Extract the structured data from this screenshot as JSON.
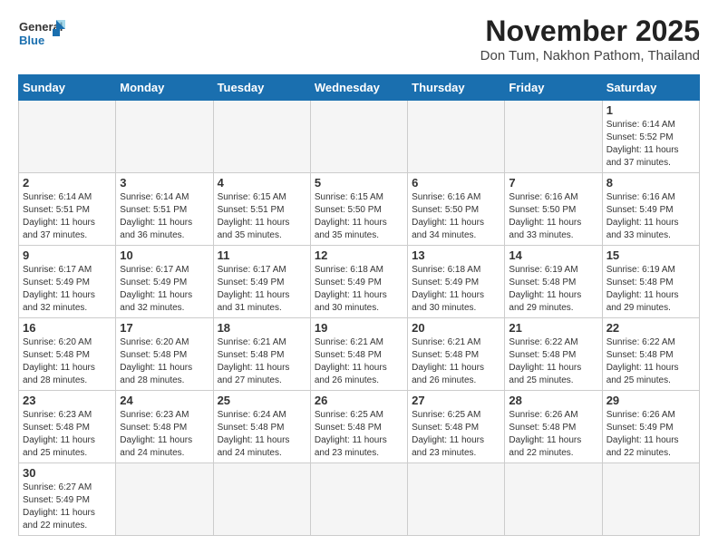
{
  "header": {
    "logo_general": "General",
    "logo_blue": "Blue",
    "month_title": "November 2025",
    "location": "Don Tum, Nakhon Pathom, Thailand"
  },
  "weekdays": [
    "Sunday",
    "Monday",
    "Tuesday",
    "Wednesday",
    "Thursday",
    "Friday",
    "Saturday"
  ],
  "days": [
    {
      "num": "",
      "info": ""
    },
    {
      "num": "",
      "info": ""
    },
    {
      "num": "",
      "info": ""
    },
    {
      "num": "",
      "info": ""
    },
    {
      "num": "",
      "info": ""
    },
    {
      "num": "",
      "info": ""
    },
    {
      "num": "1",
      "info": "Sunrise: 6:14 AM\nSunset: 5:52 PM\nDaylight: 11 hours and 37 minutes."
    },
    {
      "num": "2",
      "info": "Sunrise: 6:14 AM\nSunset: 5:51 PM\nDaylight: 11 hours and 37 minutes."
    },
    {
      "num": "3",
      "info": "Sunrise: 6:14 AM\nSunset: 5:51 PM\nDaylight: 11 hours and 36 minutes."
    },
    {
      "num": "4",
      "info": "Sunrise: 6:15 AM\nSunset: 5:51 PM\nDaylight: 11 hours and 35 minutes."
    },
    {
      "num": "5",
      "info": "Sunrise: 6:15 AM\nSunset: 5:50 PM\nDaylight: 11 hours and 35 minutes."
    },
    {
      "num": "6",
      "info": "Sunrise: 6:16 AM\nSunset: 5:50 PM\nDaylight: 11 hours and 34 minutes."
    },
    {
      "num": "7",
      "info": "Sunrise: 6:16 AM\nSunset: 5:50 PM\nDaylight: 11 hours and 33 minutes."
    },
    {
      "num": "8",
      "info": "Sunrise: 6:16 AM\nSunset: 5:49 PM\nDaylight: 11 hours and 33 minutes."
    },
    {
      "num": "9",
      "info": "Sunrise: 6:17 AM\nSunset: 5:49 PM\nDaylight: 11 hours and 32 minutes."
    },
    {
      "num": "10",
      "info": "Sunrise: 6:17 AM\nSunset: 5:49 PM\nDaylight: 11 hours and 32 minutes."
    },
    {
      "num": "11",
      "info": "Sunrise: 6:17 AM\nSunset: 5:49 PM\nDaylight: 11 hours and 31 minutes."
    },
    {
      "num": "12",
      "info": "Sunrise: 6:18 AM\nSunset: 5:49 PM\nDaylight: 11 hours and 30 minutes."
    },
    {
      "num": "13",
      "info": "Sunrise: 6:18 AM\nSunset: 5:49 PM\nDaylight: 11 hours and 30 minutes."
    },
    {
      "num": "14",
      "info": "Sunrise: 6:19 AM\nSunset: 5:48 PM\nDaylight: 11 hours and 29 minutes."
    },
    {
      "num": "15",
      "info": "Sunrise: 6:19 AM\nSunset: 5:48 PM\nDaylight: 11 hours and 29 minutes."
    },
    {
      "num": "16",
      "info": "Sunrise: 6:20 AM\nSunset: 5:48 PM\nDaylight: 11 hours and 28 minutes."
    },
    {
      "num": "17",
      "info": "Sunrise: 6:20 AM\nSunset: 5:48 PM\nDaylight: 11 hours and 28 minutes."
    },
    {
      "num": "18",
      "info": "Sunrise: 6:21 AM\nSunset: 5:48 PM\nDaylight: 11 hours and 27 minutes."
    },
    {
      "num": "19",
      "info": "Sunrise: 6:21 AM\nSunset: 5:48 PM\nDaylight: 11 hours and 26 minutes."
    },
    {
      "num": "20",
      "info": "Sunrise: 6:21 AM\nSunset: 5:48 PM\nDaylight: 11 hours and 26 minutes."
    },
    {
      "num": "21",
      "info": "Sunrise: 6:22 AM\nSunset: 5:48 PM\nDaylight: 11 hours and 25 minutes."
    },
    {
      "num": "22",
      "info": "Sunrise: 6:22 AM\nSunset: 5:48 PM\nDaylight: 11 hours and 25 minutes."
    },
    {
      "num": "23",
      "info": "Sunrise: 6:23 AM\nSunset: 5:48 PM\nDaylight: 11 hours and 25 minutes."
    },
    {
      "num": "24",
      "info": "Sunrise: 6:23 AM\nSunset: 5:48 PM\nDaylight: 11 hours and 24 minutes."
    },
    {
      "num": "25",
      "info": "Sunrise: 6:24 AM\nSunset: 5:48 PM\nDaylight: 11 hours and 24 minutes."
    },
    {
      "num": "26",
      "info": "Sunrise: 6:25 AM\nSunset: 5:48 PM\nDaylight: 11 hours and 23 minutes."
    },
    {
      "num": "27",
      "info": "Sunrise: 6:25 AM\nSunset: 5:48 PM\nDaylight: 11 hours and 23 minutes."
    },
    {
      "num": "28",
      "info": "Sunrise: 6:26 AM\nSunset: 5:48 PM\nDaylight: 11 hours and 22 minutes."
    },
    {
      "num": "29",
      "info": "Sunrise: 6:26 AM\nSunset: 5:49 PM\nDaylight: 11 hours and 22 minutes."
    },
    {
      "num": "30",
      "info": "Sunrise: 6:27 AM\nSunset: 5:49 PM\nDaylight: 11 hours and 22 minutes."
    }
  ]
}
